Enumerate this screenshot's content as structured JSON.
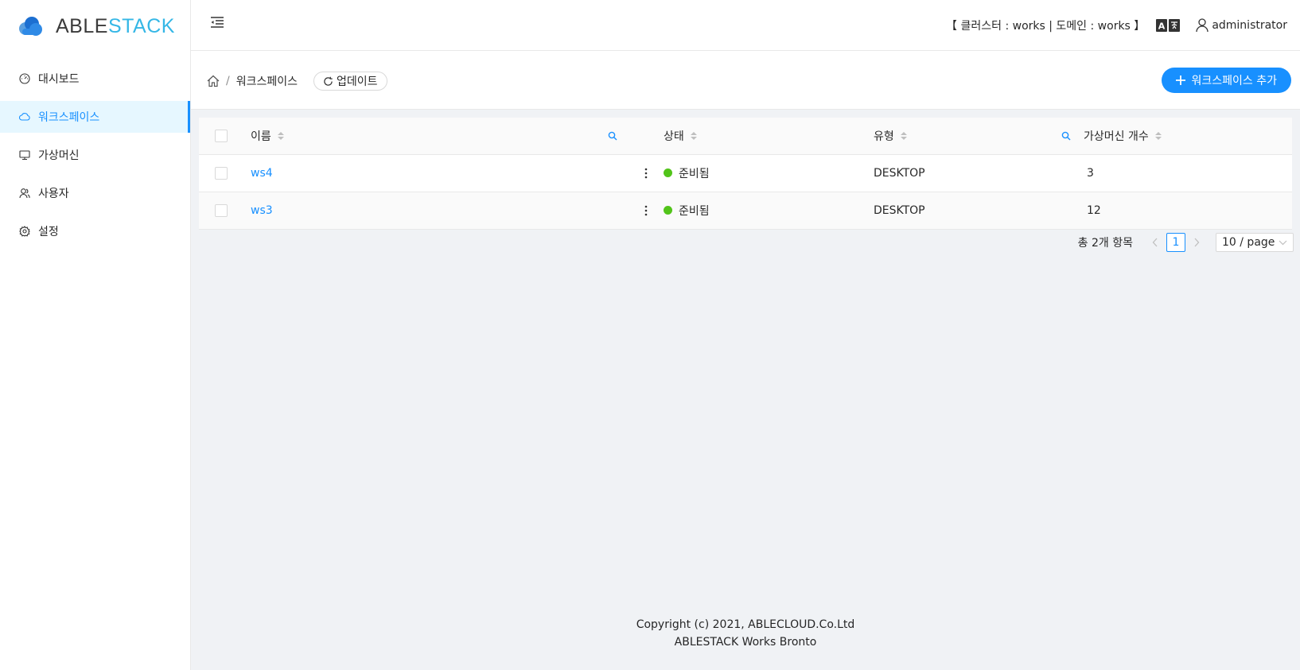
{
  "brand": {
    "part1": "ABLE",
    "part2": "STACK",
    "accent": "#35b7e6"
  },
  "sidebar": {
    "items": [
      {
        "label": "대시보드",
        "icon": "dashboard-icon",
        "active": false
      },
      {
        "label": "워크스페이스",
        "icon": "cloud-icon",
        "active": true
      },
      {
        "label": "가상머신",
        "icon": "desktop-icon",
        "active": false
      },
      {
        "label": "사용자",
        "icon": "user-icon",
        "active": false
      },
      {
        "label": "설정",
        "icon": "gear-icon",
        "active": false
      }
    ]
  },
  "header": {
    "cluster_info": "【 클러스터 : works  |  도메인 : works 】",
    "username": "administrator"
  },
  "page": {
    "breadcrumb_current": "워크스페이스",
    "refresh_label": "업데이트",
    "add_label": "워크스페이스 추가"
  },
  "table": {
    "columns": {
      "name": "이름",
      "status": "상태",
      "type": "유형",
      "vm_count": "가상머신 개수"
    },
    "rows": [
      {
        "name": "ws4",
        "status": "준비됨",
        "type": "DESKTOP",
        "vm_count": "3"
      },
      {
        "name": "ws3",
        "status": "준비됨",
        "type": "DESKTOP",
        "vm_count": "12"
      }
    ]
  },
  "pagination": {
    "total": "총 2개 항목",
    "current": "1",
    "page_size": "10 / page"
  },
  "footer": {
    "line1": "Copyright (c) 2021, ABLECLOUD.Co.Ltd",
    "line2": "ABLESTACK Works Bronto"
  },
  "colors": {
    "primary": "#1890ff",
    "success": "#52c41a"
  }
}
